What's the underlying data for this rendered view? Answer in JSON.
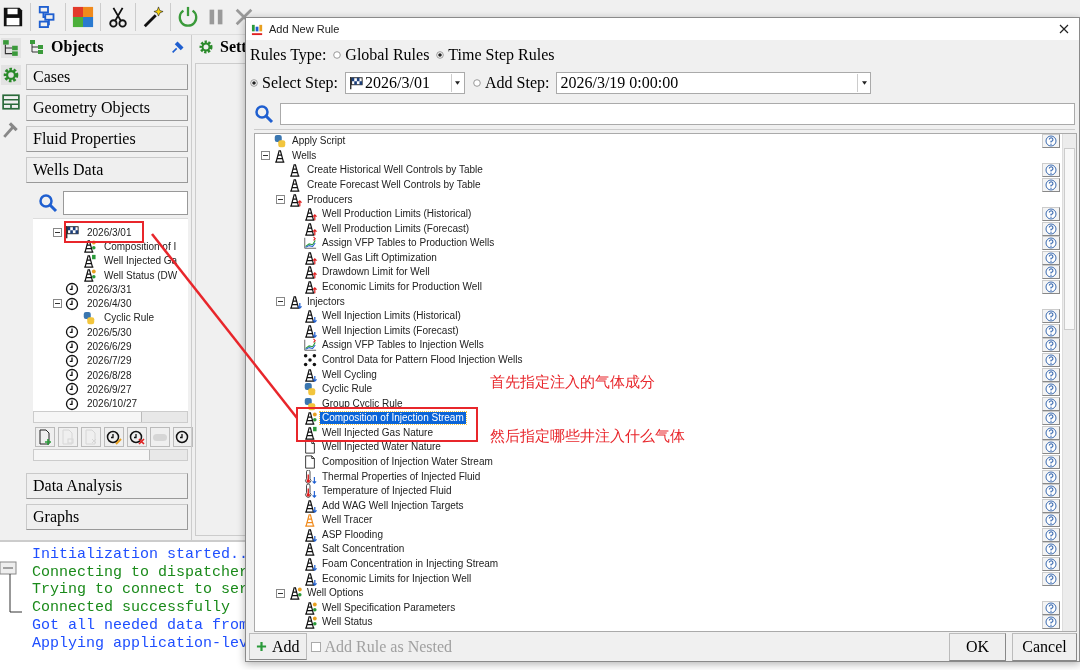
{
  "objects_panel": {
    "title": "Objects",
    "sections_top": [
      "Cases",
      "Geometry Objects",
      "Fluid Properties",
      "Wells Data"
    ],
    "tree": [
      {
        "label": "2026/3/01",
        "kind": "flag",
        "expanded": true,
        "children": [
          {
            "label": "Composition of I",
            "kind": "derrick-dot"
          },
          {
            "label": "Well Injected Ga",
            "kind": "derrick-g"
          },
          {
            "label": "Well Status (DW",
            "kind": "derrick-dot"
          }
        ]
      },
      {
        "label": "2026/3/31",
        "kind": "clock"
      },
      {
        "label": "2026/4/30",
        "kind": "clock",
        "expanded": true,
        "children": [
          {
            "label": "Cyclic Rule",
            "kind": "python"
          }
        ]
      },
      {
        "label": "2026/5/30",
        "kind": "clock"
      },
      {
        "label": "2026/6/29",
        "kind": "clock"
      },
      {
        "label": "2026/7/29",
        "kind": "clock"
      },
      {
        "label": "2026/8/28",
        "kind": "clock"
      },
      {
        "label": "2026/9/27",
        "kind": "clock"
      },
      {
        "label": "2026/10/27",
        "kind": "clock"
      }
    ],
    "tool_buttons": [
      {
        "kind": "new",
        "disabled": false
      },
      {
        "kind": "copy",
        "disabled": true
      },
      {
        "kind": "delete",
        "disabled": true
      },
      {
        "kind": "clock-edit",
        "disabled": false
      },
      {
        "kind": "clock-delete",
        "disabled": false
      },
      {
        "kind": "switch",
        "disabled": true
      },
      {
        "kind": "clock",
        "disabled": false
      }
    ],
    "sections_bottom": [
      "Data Analysis",
      "Graphs"
    ]
  },
  "settings_panel": {
    "title": "Sett"
  },
  "log": [
    {
      "text": "Initialization started..",
      "color": "#1f4fff"
    },
    {
      "text": "Connecting to dispatcher",
      "color": "#1a8a1a"
    },
    {
      "text": "Trying to connect to ser",
      "color": "#1a8a1a"
    },
    {
      "text": "Connected successfully",
      "color": "#1a8a1a"
    },
    {
      "text": "Got all needed data from",
      "color": "#1f4fff"
    },
    {
      "text": "Applying application-lev",
      "color": "#1f4fff"
    }
  ],
  "dialog": {
    "title": "Add New Rule",
    "rules_type": {
      "label": "Rules Type:",
      "options": [
        {
          "label": "Global Rules",
          "selected": false
        },
        {
          "label": "Time Step Rules",
          "selected": true
        }
      ]
    },
    "steps": [
      {
        "label": "Select Step:",
        "selected": true,
        "value": "2026/3/01",
        "kind": "flag"
      },
      {
        "label": "Add Step:",
        "selected": false,
        "value": "2026/3/19 0:00:00",
        "kind": "plain"
      }
    ],
    "rule_tree": [
      {
        "label": "Apply Script",
        "kind": "python",
        "help": true,
        "selected": false
      },
      {
        "label": "Wells",
        "kind": "derrick",
        "selected": false,
        "expanded": true,
        "children": [
          {
            "label": "Create Historical Well Controls by Table",
            "kind": "derrick",
            "help": true,
            "selected": false
          },
          {
            "label": "Create Forecast Well Controls by Table",
            "kind": "derrick",
            "help": true,
            "selected": false
          },
          {
            "label": "Producers",
            "kind": "derrick-up",
            "selected": false,
            "expanded": true,
            "children": [
              {
                "label": "Well Production Limits (Historical)",
                "kind": "derrick-up",
                "help": true,
                "selected": false
              },
              {
                "label": "Well Production Limits (Forecast)",
                "kind": "derrick-up",
                "help": true,
                "selected": false
              },
              {
                "label": "Assign VFP Tables to Production Wells",
                "kind": "vfp",
                "help": true,
                "selected": false
              },
              {
                "label": "Well Gas Lift Optimization",
                "kind": "derrick-up",
                "help": true,
                "selected": false
              },
              {
                "label": "Drawdown Limit for Well",
                "kind": "derrick-up",
                "help": true,
                "selected": false
              },
              {
                "label": "Economic Limits for Production Well",
                "kind": "derrick-up",
                "help": true,
                "selected": false
              }
            ]
          },
          {
            "label": "Injectors",
            "kind": "derrick-down",
            "selected": false,
            "expanded": true,
            "children": [
              {
                "label": "Well Injection Limits (Historical)",
                "kind": "derrick-down",
                "help": true,
                "selected": false
              },
              {
                "label": "Well Injection Limits (Forecast)",
                "kind": "derrick-down",
                "help": true,
                "selected": false
              },
              {
                "label": "Assign VFP Tables to Injection Wells",
                "kind": "vfp",
                "help": true,
                "selected": false
              },
              {
                "label": "Control Data for Pattern Flood Injection Wells",
                "kind": "dots",
                "help": true,
                "selected": false
              },
              {
                "label": "Well Cycling",
                "kind": "derrick-down",
                "help": true,
                "selected": false
              },
              {
                "label": "Cyclic Rule",
                "kind": "python",
                "help": true,
                "selected": false
              },
              {
                "label": "Group Cyclic Rule",
                "kind": "python",
                "help": true,
                "selected": false
              },
              {
                "label": "Composition of Injection Stream",
                "kind": "derrick-dot",
                "help": true,
                "selected": true
              },
              {
                "label": "Well Injected Gas Nature",
                "kind": "derrick-g",
                "help": true,
                "selected": false
              },
              {
                "label": "Well Injected Water Nature",
                "kind": "page",
                "help": true,
                "selected": false
              },
              {
                "label": "Composition of Injection Water Stream",
                "kind": "page",
                "help": true,
                "selected": false
              },
              {
                "label": "Thermal Properties of Injected Fluid",
                "kind": "thermo",
                "help": true,
                "selected": false
              },
              {
                "label": "Temperature of Injected Fluid",
                "kind": "thermo",
                "help": true,
                "selected": false
              },
              {
                "label": "Add WAG Well Injection Targets",
                "kind": "derrick-down",
                "help": true,
                "selected": false
              },
              {
                "label": "Well Tracer",
                "kind": "tracer",
                "help": true,
                "selected": false
              },
              {
                "label": "ASP Flooding",
                "kind": "derrick-down",
                "help": true,
                "selected": false
              },
              {
                "label": "Salt Concentration",
                "kind": "derrick",
                "help": true,
                "selected": false
              },
              {
                "label": "Foam Concentration in Injecting Stream",
                "kind": "derrick-down",
                "help": true,
                "selected": false
              },
              {
                "label": "Economic Limits for Injection Well",
                "kind": "derrick-down",
                "help": true,
                "selected": false
              }
            ]
          },
          {
            "label": "Well Options",
            "kind": "derrick-dot",
            "selected": false,
            "expanded": true,
            "children": [
              {
                "label": "Well Specification Parameters",
                "kind": "derrick-dot",
                "help": true,
                "selected": false
              },
              {
                "label": "Well Status",
                "kind": "derrick-dot",
                "help": true,
                "selected": false
              }
            ]
          }
        ]
      }
    ],
    "add_button": "Add",
    "nested_option": {
      "label": "Add Rule as Nested",
      "checked": false,
      "disabled": true
    },
    "buttons": [
      "OK",
      "Cancel"
    ]
  },
  "annotations": [
    "首先指定注入的气体成分",
    "然后指定哪些井注入什么气体"
  ]
}
